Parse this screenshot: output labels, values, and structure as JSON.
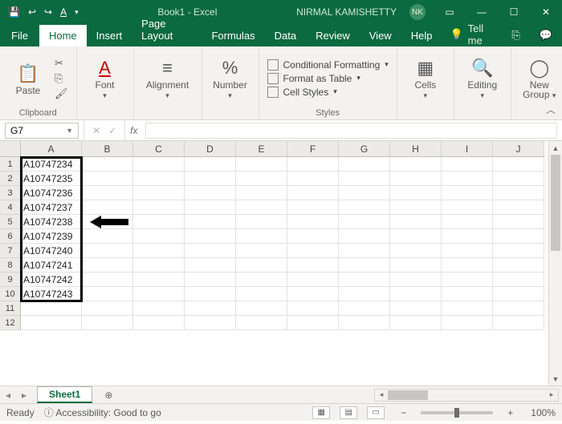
{
  "titlebar": {
    "doc_title": "Book1 - Excel",
    "user_name": "NIRMAL KAMISHETTY",
    "user_initials": "NK"
  },
  "tabs": {
    "file": "File",
    "home": "Home",
    "insert": "Insert",
    "page_layout": "Page Layout",
    "formulas": "Formulas",
    "data": "Data",
    "review": "Review",
    "view": "View",
    "help": "Help",
    "tell_me": "Tell me"
  },
  "ribbon": {
    "clipboard": {
      "paste": "Paste",
      "label": "Clipboard"
    },
    "font": {
      "btn": "Font",
      "label": ""
    },
    "alignment": {
      "btn": "Alignment",
      "label": ""
    },
    "number": {
      "btn": "Number",
      "label": ""
    },
    "styles": {
      "cond_fmt": "Conditional Formatting",
      "fmt_table": "Format as Table",
      "cell_styles": "Cell Styles",
      "label": "Styles"
    },
    "cells": {
      "btn": "Cells"
    },
    "editing": {
      "btn": "Editing"
    },
    "newgroup": {
      "btn1": "New",
      "btn2": "Group"
    }
  },
  "formula_bar": {
    "name_box": "G7",
    "formula": ""
  },
  "grid": {
    "columns": [
      "A",
      "B",
      "C",
      "D",
      "E",
      "F",
      "G",
      "H",
      "I",
      "J"
    ],
    "rows": [
      "1",
      "2",
      "3",
      "4",
      "5",
      "6",
      "7",
      "8",
      "9",
      "10",
      "11",
      "12"
    ],
    "colA_values": [
      "A10747234",
      "A10747235",
      "A10747236",
      "A10747237",
      "A10747238",
      "A10747239",
      "A10747240",
      "A10747241",
      "A10747242",
      "A10747243",
      "",
      ""
    ]
  },
  "sheet_tabs": {
    "sheet1": "Sheet1"
  },
  "status": {
    "ready": "Ready",
    "accessibility": "Accessibility: Good to go",
    "zoom": "100%"
  }
}
